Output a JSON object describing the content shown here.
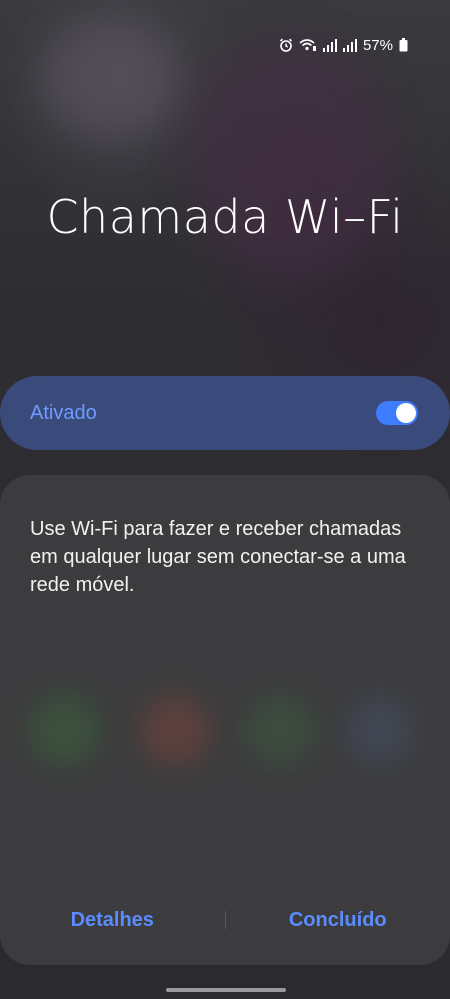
{
  "status_bar": {
    "battery_percent": "57%",
    "icons": [
      "alarm-icon",
      "wifi-calling-icon",
      "signal-icon",
      "signal-icon",
      "battery-icon"
    ]
  },
  "page": {
    "title": "Chamada Wi–Fi"
  },
  "toggle": {
    "label": "Ativado",
    "state": "on",
    "accent": "#3f7dff"
  },
  "sheet": {
    "description": "Use Wi-Fi para fazer e receber chamadas em qualquer lugar sem conectar-se a uma rede móvel.",
    "buttons": {
      "details": "Detalhes",
      "done": "Concluído"
    }
  }
}
